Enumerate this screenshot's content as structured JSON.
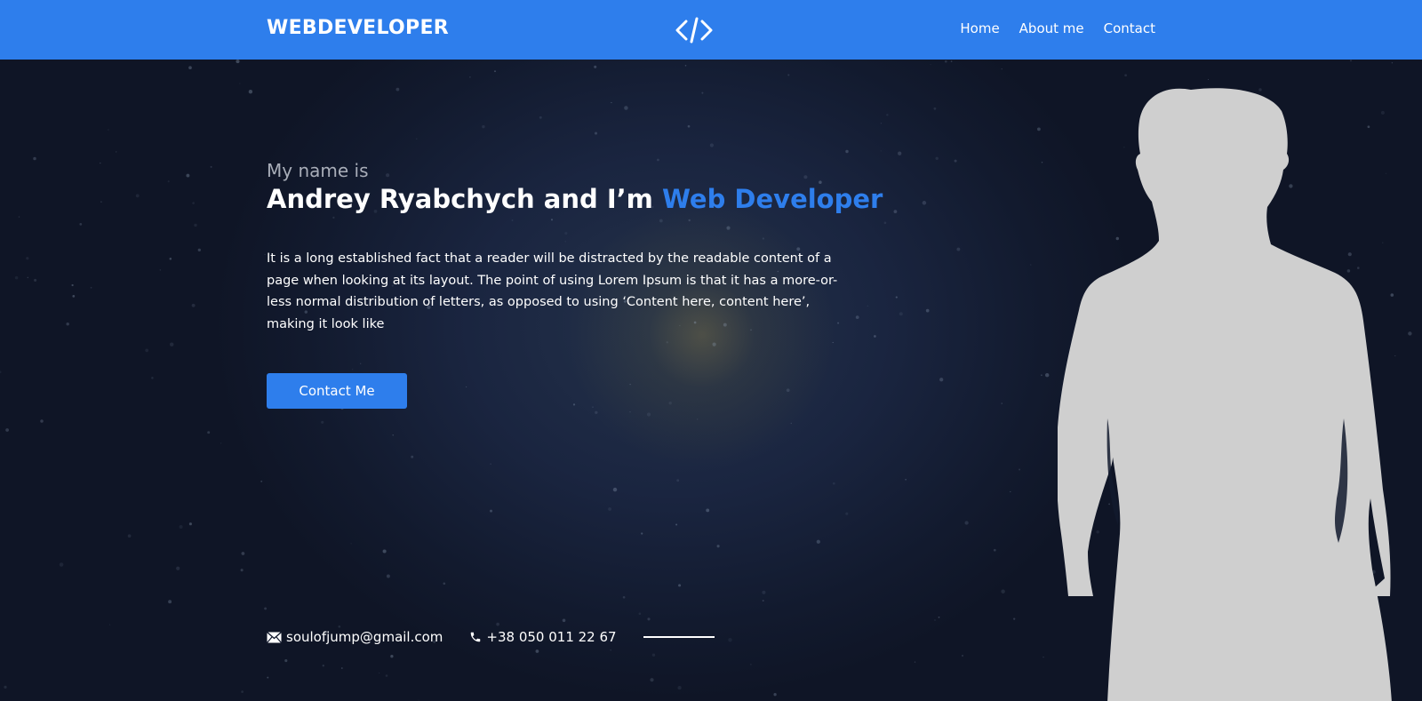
{
  "header": {
    "logo": "WEBDEVELOPER",
    "center_icon": "code-icon",
    "nav": [
      {
        "label": "Home"
      },
      {
        "label": "About me"
      },
      {
        "label": "Contact"
      }
    ]
  },
  "hero": {
    "intro": "My name is",
    "headline_prefix": "Andrey Ryabchych and I’m ",
    "headline_accent": "Web Developer",
    "description": "It is a long established fact that a reader will be distracted by the readable content of a page when looking at its layout. The point of using Lorem Ipsum is that it has a more-or-less normal distribution of letters, as opposed to using ‘Content here, content here’, making it look like",
    "button_label": "Contact Me",
    "portrait": "person-silhouette"
  },
  "contacts": {
    "email_icon": "envelope-icon",
    "email": "soulofjump@gmail.com",
    "phone_icon": "phone-icon",
    "phone": "+38 050 011 22 67"
  },
  "colors": {
    "accent": "#2e7eec",
    "background": "#121a2e",
    "silhouette": "#cfcfcf"
  }
}
